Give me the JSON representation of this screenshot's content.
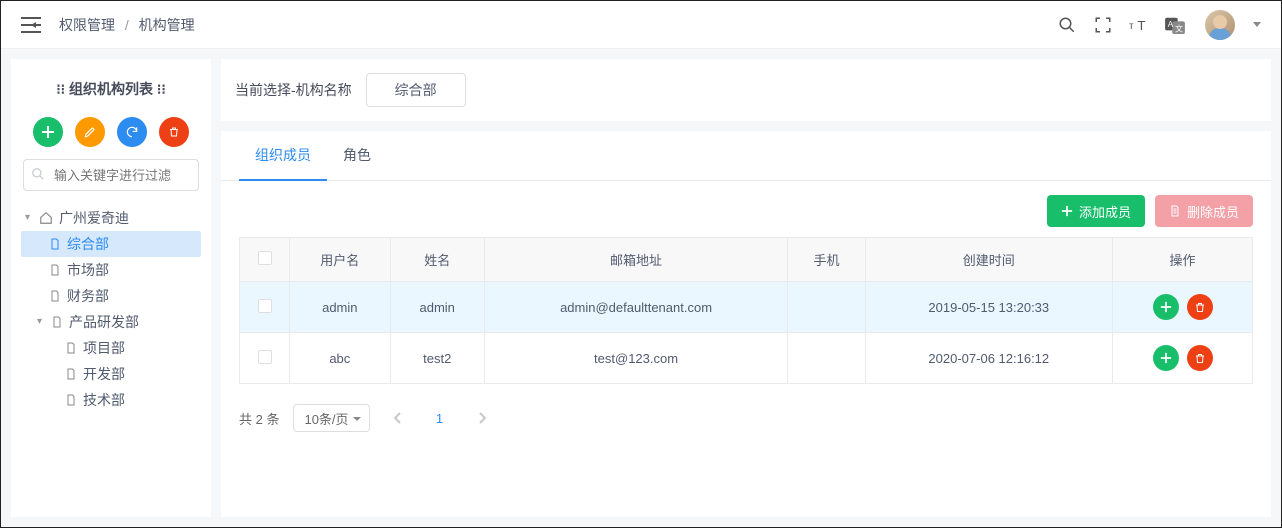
{
  "breadcrumb": {
    "a": "权限管理",
    "b": "机构管理"
  },
  "topicons": {
    "search": "search-icon",
    "fullscreen": "fullscreen-icon",
    "text": "textsize-icon",
    "lang": "language-icon"
  },
  "sidebar": {
    "title": "⁝⁝ 组织机构列表 ⁝⁝",
    "search_placeholder": "输入关键字进行过滤",
    "tree": {
      "root": "广州爱奇迪",
      "n1": "综合部",
      "n2": "市场部",
      "n3": "财务部",
      "n4": "产品研发部",
      "n4a": "项目部",
      "n4b": "开发部",
      "n4c": "技术部"
    }
  },
  "selection": {
    "label": "当前选择-机构名称",
    "value": "综合部"
  },
  "tabs": {
    "members": "组织成员",
    "roles": "角色"
  },
  "toolbar": {
    "add": "添加成员",
    "del": "删除成员"
  },
  "table": {
    "headers": {
      "user": "用户名",
      "name": "姓名",
      "email": "邮箱地址",
      "phone": "手机",
      "created": "创建时间",
      "ops": "操作"
    },
    "rows": [
      {
        "user": "admin",
        "name": "admin",
        "email": "admin@defaulttenant.com",
        "phone": "",
        "created": "2019-05-15 13:20:33"
      },
      {
        "user": "abc",
        "name": "test2",
        "email": "test@123.com",
        "phone": "",
        "created": "2020-07-06 12:16:12"
      }
    ]
  },
  "pager": {
    "total_label": "共 2 条",
    "pagesize": "10条/页",
    "current": "1"
  }
}
